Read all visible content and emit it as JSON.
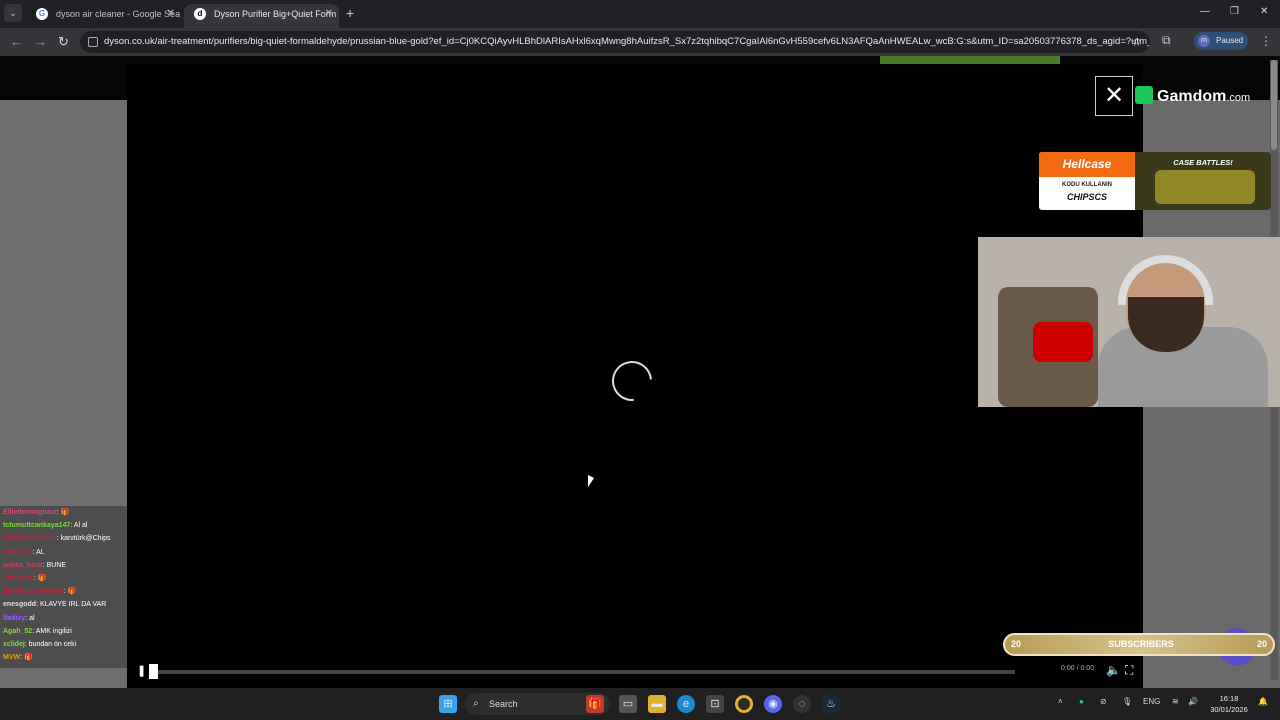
{
  "browser": {
    "tabs": [
      {
        "title": "dyson air cleaner - Google Sea",
        "favicon": "google-icon",
        "active": false
      },
      {
        "title": "Dyson Purifier Big+Quiet Form",
        "favicon": "dyson-icon",
        "active": true
      }
    ],
    "url": "dyson.co.uk/air-treatment/purifiers/big-quiet-formaldehyde/prussian-blue-gold?ef_id=Cj0KCQiAyvHLBhDlARIsAHxl6xqMwng8hAuifzsR_Sx7z2tqhibqC7CgaIAl6nGvH559cefv6LN3AFQaAnHWEALw_wcB:G:s&utm_ID=sa20503776378_ds_agid=?utm_...",
    "profile_initial": "m",
    "profile_status": "Paused"
  },
  "player": {
    "time": "0:00 / 0:00",
    "progress_fraction": 0.0
  },
  "overlay": {
    "brand": "Gamdom",
    "brand_suffix": ".com",
    "close_glyph": "✕"
  },
  "hellcase": {
    "brand": "Hellcase",
    "line1": "KODU KULLANIN",
    "code": "CHIPSCS",
    "headline": "CASE BATTLES!"
  },
  "chat": {
    "lines": [
      {
        "user": "Ellieltevoogtuse",
        "msg": ": 🎁",
        "color": "#e0457b"
      },
      {
        "user": "tctumuttcankaya147",
        "msg": ": Al al",
        "color": "#7ddc3a"
      },
      {
        "user": "darmanibasamo",
        "msg": ": kanıtürk@Chips",
        "color": "#c0203a"
      },
      {
        "user": "Radeson",
        "msg": ": AL",
        "color": "#c0203a"
      },
      {
        "user": "ankea_bask",
        "msg": ": BUNE",
        "color": "#d43c5a"
      },
      {
        "user": "Ebbesi16",
        "msg": ": 🎁",
        "color": "#c0203a"
      },
      {
        "user": "Emeltbyesyleyaeu",
        "msg": ": 🎁",
        "color": "#c0203a"
      },
      {
        "user": "enesgodd",
        "msg": ": KLAVYE IRL DA VAR",
        "color": "#dddddd"
      },
      {
        "user": "lfadixy",
        "msg": ": al",
        "color": "#9a5cff"
      },
      {
        "user": "Agah_52",
        "msg": ": AMK ingilizi",
        "color": "#7ddc3a"
      },
      {
        "user": "xclidej",
        "msg": ": bundan ön ceki",
        "color": "#7ddc3a"
      },
      {
        "user": "MVW",
        "msg": ": 🎁",
        "color": "#e0a000"
      }
    ]
  },
  "subscribers": {
    "label": "SUBSCRIBERS",
    "current": "20",
    "goal": "20"
  },
  "taskbar": {
    "search_label": "Search",
    "language": "ENG",
    "time": "16:18",
    "date": "30/01/2026"
  }
}
